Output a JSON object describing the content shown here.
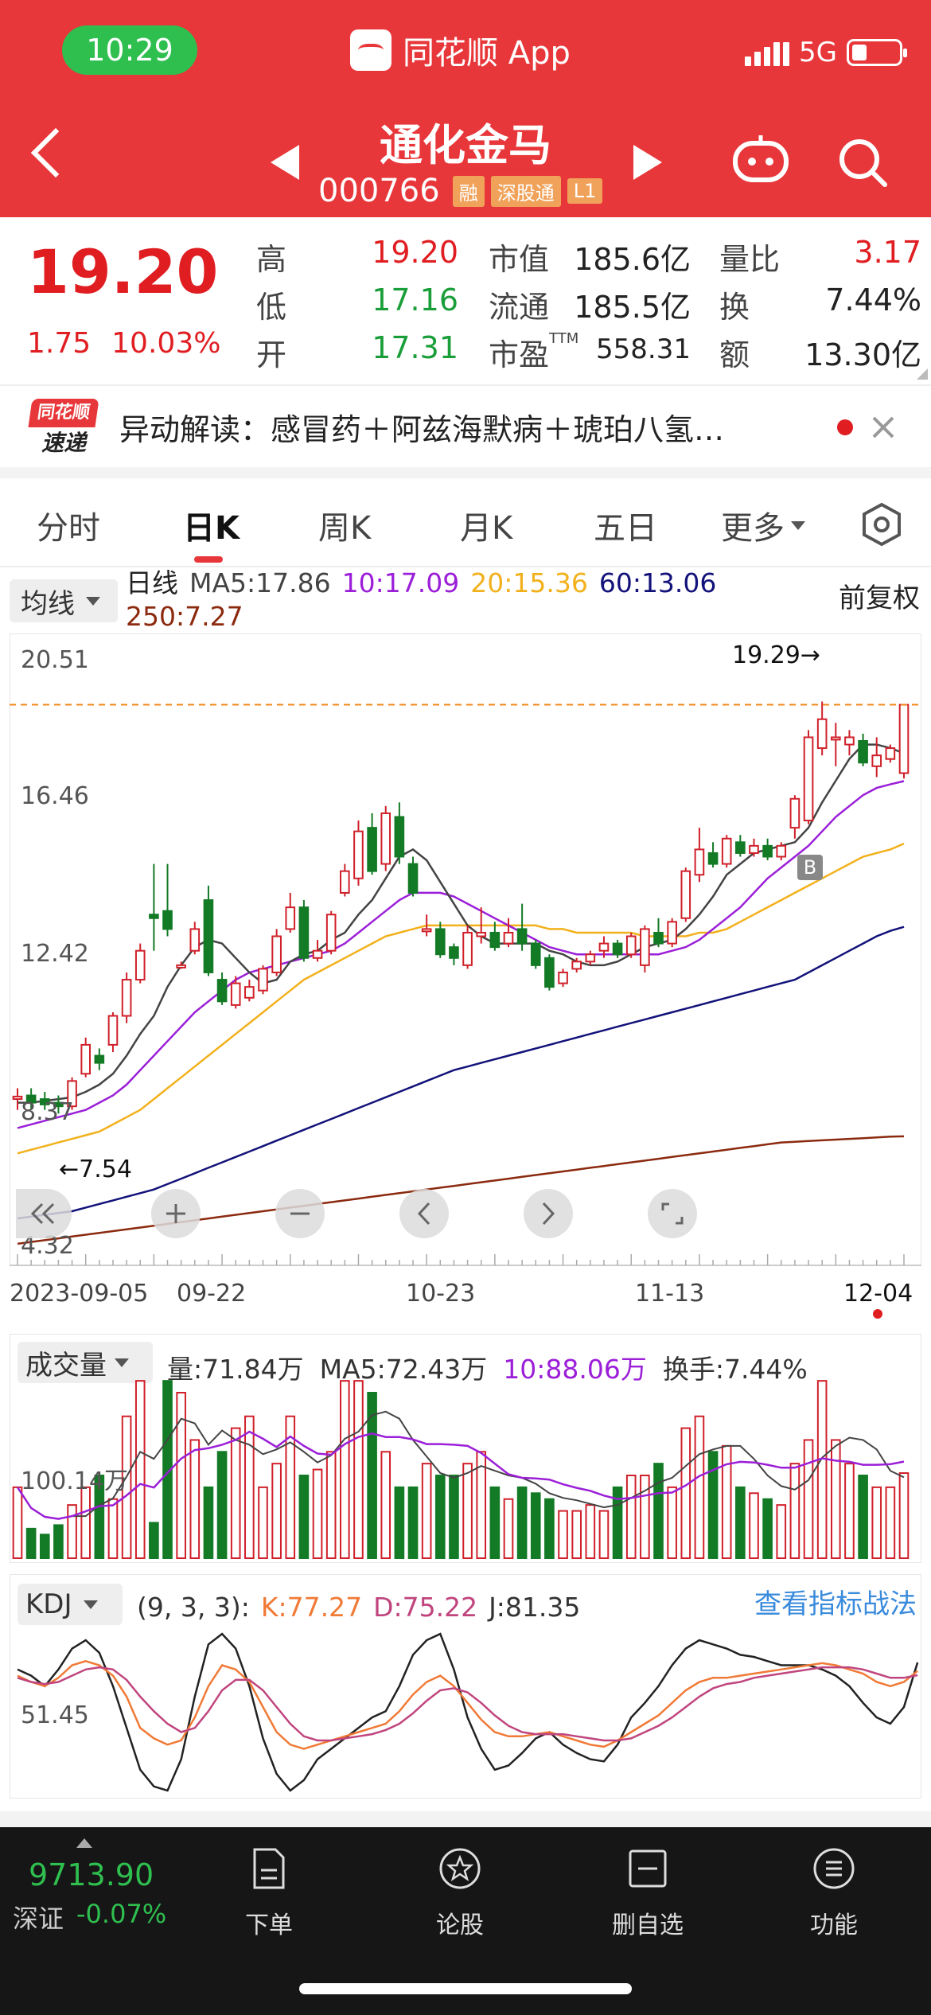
{
  "status_bar": {
    "time": "10:29",
    "app_name": "同花顺 App",
    "network": "5G"
  },
  "header": {
    "stock_name": "通化金马",
    "stock_code": "000766",
    "badges": [
      "融",
      "深股通",
      "L1"
    ]
  },
  "quote": {
    "price": "19.20",
    "change": "1.75",
    "change_pct": "10.03%",
    "high_label": "高",
    "high": "19.20",
    "low_label": "低",
    "low": "17.16",
    "open_label": "开",
    "open": "17.31",
    "mcap_label": "市值",
    "mcap": "185.6亿",
    "float_label": "流通",
    "float": "185.5亿",
    "pe_label": "市盈",
    "pe_sup": "TTM",
    "pe": "558.31",
    "vol_ratio_label": "量比",
    "vol_ratio": "3.17",
    "turnover_label": "换",
    "turnover": "7.44%",
    "amount_label": "额",
    "amount": "13.30亿"
  },
  "news": {
    "logo_top": "同花顺",
    "logo_bottom": "速递",
    "text": "异动解读：感冒药＋阿兹海默病＋琥珀八氢…"
  },
  "tabs": [
    "分时",
    "日K",
    "周K",
    "月K",
    "五日",
    "更多"
  ],
  "active_tab": "日K",
  "ma_legend": {
    "select_label": "均线",
    "type": "日线",
    "ma5": "MA5:17.86",
    "ma10": "10:17.09",
    "ma20": "20:15.36",
    "ma60": "60:13.06",
    "ma250": "250:7.27",
    "adjust": "前复权"
  },
  "colors": {
    "up": "#d0202a",
    "down": "#137a25",
    "ma5": "#444444",
    "ma10": "#9b1fd8",
    "ma20": "#f2b11c",
    "ma60": "#12127a",
    "ma250": "#8b2a0f",
    "k": "#f07a36",
    "d": "#c0457e",
    "j": "#222222"
  },
  "chart_labels": {
    "y_ticks": [
      "20.51",
      "16.46",
      "12.42",
      "8.37",
      "4.32"
    ],
    "x_ticks": [
      "2023-09-05",
      "09-22",
      "10-23",
      "11-13",
      "12-04"
    ],
    "max_marker": "19.29→",
    "min_marker": "←7.54",
    "buy_marker": "B"
  },
  "volume": {
    "select_label": "成交量",
    "vol": "量:71.84万",
    "ma5": "MA5:72.43万",
    "ma10": "10:88.06万",
    "turnover": "换手:7.44%",
    "y_tick": "100.14万"
  },
  "kdj": {
    "select_label": "KDJ",
    "params": "(9, 3, 3):",
    "k": "K:77.27",
    "d": "D:75.22",
    "j": "J:81.35",
    "link": "查看指标战法",
    "y_tick": "51.45"
  },
  "bottom": {
    "index_value": "9713.90",
    "index_name": "深证",
    "index_change": "-0.07%",
    "nav": [
      "下单",
      "论股",
      "删自选",
      "功能"
    ]
  },
  "chart_data": {
    "type": "candlestick",
    "ylim": [
      4.32,
      20.51
    ],
    "y_ticks": [
      20.51,
      16.46,
      12.42,
      8.37,
      4.32
    ],
    "x_ticks": [
      "2023-09-05",
      "09-22",
      "10-23",
      "11-13",
      "12-04"
    ],
    "candles": [
      {
        "o": 8.3,
        "c": 8.37,
        "h": 8.6,
        "l": 8.0
      },
      {
        "o": 8.4,
        "c": 8.2,
        "h": 8.6,
        "l": 8.0
      },
      {
        "o": 8.3,
        "c": 8.15,
        "h": 8.5,
        "l": 8.0
      },
      {
        "o": 8.2,
        "c": 8.1,
        "h": 8.4,
        "l": 7.9
      },
      {
        "o": 8.1,
        "c": 8.8,
        "h": 8.9,
        "l": 8.0
      },
      {
        "o": 9.0,
        "c": 9.8,
        "h": 10.0,
        "l": 8.9
      },
      {
        "o": 9.5,
        "c": 9.3,
        "h": 9.7,
        "l": 9.1
      },
      {
        "o": 9.8,
        "c": 10.6,
        "h": 10.7,
        "l": 9.6
      },
      {
        "o": 10.6,
        "c": 11.6,
        "h": 11.8,
        "l": 10.4
      },
      {
        "o": 11.6,
        "c": 12.4,
        "h": 12.6,
        "l": 11.5
      },
      {
        "o": 13.4,
        "c": 13.3,
        "h": 14.8,
        "l": 12.4
      },
      {
        "o": 13.5,
        "c": 13.0,
        "h": 14.8,
        "l": 12.8
      },
      {
        "o": 12.0,
        "c": 12.0,
        "h": 12.1,
        "l": 11.9
      },
      {
        "o": 12.4,
        "c": 13.0,
        "h": 13.2,
        "l": 12.3
      },
      {
        "o": 13.8,
        "c": 11.8,
        "h": 14.2,
        "l": 11.7
      },
      {
        "o": 11.6,
        "c": 11.0,
        "h": 11.8,
        "l": 10.9
      },
      {
        "o": 10.9,
        "c": 11.5,
        "h": 11.7,
        "l": 10.8
      },
      {
        "o": 11.1,
        "c": 11.4,
        "h": 11.6,
        "l": 11.0
      },
      {
        "o": 11.3,
        "c": 11.9,
        "h": 12.0,
        "l": 11.2
      },
      {
        "o": 11.8,
        "c": 12.8,
        "h": 13.0,
        "l": 11.7
      },
      {
        "o": 13.0,
        "c": 13.6,
        "h": 14.0,
        "l": 12.9
      },
      {
        "o": 13.6,
        "c": 12.2,
        "h": 13.8,
        "l": 12.1
      },
      {
        "o": 12.2,
        "c": 12.4,
        "h": 12.7,
        "l": 12.1
      },
      {
        "o": 12.4,
        "c": 13.4,
        "h": 13.5,
        "l": 12.3
      },
      {
        "o": 14.0,
        "c": 14.6,
        "h": 14.8,
        "l": 13.9
      },
      {
        "o": 14.4,
        "c": 15.7,
        "h": 16.0,
        "l": 14.2
      },
      {
        "o": 15.8,
        "c": 14.6,
        "h": 16.2,
        "l": 14.5
      },
      {
        "o": 14.8,
        "c": 16.2,
        "h": 16.4,
        "l": 14.6
      },
      {
        "o": 16.1,
        "c": 15.0,
        "h": 16.5,
        "l": 14.8
      },
      {
        "o": 14.8,
        "c": 14.0,
        "h": 15.0,
        "l": 13.9
      },
      {
        "o": 13.0,
        "c": 13.0,
        "h": 13.4,
        "l": 12.8
      },
      {
        "o": 13.0,
        "c": 12.3,
        "h": 13.2,
        "l": 12.2
      },
      {
        "o": 12.5,
        "c": 12.2,
        "h": 12.6,
        "l": 12.0
      },
      {
        "o": 12.0,
        "c": 12.9,
        "h": 13.1,
        "l": 11.9
      },
      {
        "o": 12.8,
        "c": 12.9,
        "h": 13.6,
        "l": 12.6
      },
      {
        "o": 12.9,
        "c": 12.5,
        "h": 13.2,
        "l": 12.4
      },
      {
        "o": 12.6,
        "c": 12.9,
        "h": 13.3,
        "l": 12.5
      },
      {
        "o": 13.0,
        "c": 12.6,
        "h": 13.7,
        "l": 12.4
      },
      {
        "o": 12.6,
        "c": 12.0,
        "h": 12.7,
        "l": 11.9
      },
      {
        "o": 12.2,
        "c": 11.4,
        "h": 12.3,
        "l": 11.3
      },
      {
        "o": 11.5,
        "c": 11.8,
        "h": 11.9,
        "l": 11.4
      },
      {
        "o": 11.9,
        "c": 12.1,
        "h": 12.2,
        "l": 11.8
      },
      {
        "o": 12.1,
        "c": 12.3,
        "h": 12.4,
        "l": 12.0
      },
      {
        "o": 12.4,
        "c": 12.6,
        "h": 12.8,
        "l": 12.2
      },
      {
        "o": 12.6,
        "c": 12.3,
        "h": 12.7,
        "l": 12.2
      },
      {
        "o": 12.3,
        "c": 12.8,
        "h": 12.9,
        "l": 12.2
      },
      {
        "o": 12.0,
        "c": 13.0,
        "h": 13.1,
        "l": 11.8
      },
      {
        "o": 12.9,
        "c": 12.6,
        "h": 13.3,
        "l": 12.5
      },
      {
        "o": 12.6,
        "c": 13.2,
        "h": 13.3,
        "l": 12.5
      },
      {
        "o": 13.3,
        "c": 14.6,
        "h": 14.7,
        "l": 13.2
      },
      {
        "o": 14.5,
        "c": 15.2,
        "h": 15.8,
        "l": 14.3
      },
      {
        "o": 15.1,
        "c": 14.8,
        "h": 15.4,
        "l": 14.7
      },
      {
        "o": 14.8,
        "c": 15.5,
        "h": 15.6,
        "l": 14.7
      },
      {
        "o": 15.4,
        "c": 15.1,
        "h": 15.6,
        "l": 15.0
      },
      {
        "o": 15.1,
        "c": 15.3,
        "h": 15.5,
        "l": 15.0
      },
      {
        "o": 15.3,
        "c": 15.0,
        "h": 15.5,
        "l": 14.9
      },
      {
        "o": 15.0,
        "c": 15.3,
        "h": 15.4,
        "l": 14.9
      },
      {
        "o": 15.8,
        "c": 16.6,
        "h": 16.7,
        "l": 15.5
      },
      {
        "o": 16.0,
        "c": 18.3,
        "h": 18.5,
        "l": 15.9
      },
      {
        "o": 18.0,
        "c": 18.8,
        "h": 19.29,
        "l": 17.8
      },
      {
        "o": 18.3,
        "c": 18.3,
        "h": 18.7,
        "l": 17.5
      },
      {
        "o": 18.1,
        "c": 18.3,
        "h": 18.5,
        "l": 17.8
      },
      {
        "o": 18.2,
        "c": 17.6,
        "h": 18.4,
        "l": 17.5
      },
      {
        "o": 17.5,
        "c": 17.8,
        "h": 18.3,
        "l": 17.2
      },
      {
        "o": 17.7,
        "c": 18.0,
        "h": 18.1,
        "l": 17.6
      },
      {
        "o": 17.31,
        "c": 19.2,
        "h": 19.2,
        "l": 17.16
      }
    ],
    "ma5": [
      8.2,
      8.2,
      8.25,
      8.3,
      8.35,
      8.5,
      8.7,
      9.0,
      9.5,
      10.1,
      10.6,
      11.4,
      12.0,
      12.5,
      12.7,
      12.6,
      12.2,
      11.8,
      11.5,
      11.6,
      12.1,
      12.3,
      12.4,
      12.7,
      12.9,
      13.4,
      13.8,
      14.4,
      15.0,
      15.2,
      14.9,
      14.3,
      13.7,
      13.1,
      12.8,
      12.6,
      12.6,
      12.6,
      12.6,
      12.4,
      12.3,
      12.1,
      12.0,
      12.0,
      12.1,
      12.3,
      12.5,
      12.6,
      12.7,
      13.0,
      13.4,
      13.9,
      14.5,
      14.8,
      15.1,
      15.2,
      15.3,
      15.4,
      15.8,
      16.5,
      17.1,
      17.7,
      18.1,
      18.1,
      18.0,
      17.86
    ],
    "ma10": [
      7.5,
      7.6,
      7.7,
      7.8,
      7.9,
      8.0,
      8.2,
      8.4,
      8.7,
      9.1,
      9.5,
      9.9,
      10.3,
      10.7,
      11.0,
      11.3,
      11.6,
      11.8,
      11.9,
      12.0,
      12.1,
      12.2,
      12.3,
      12.4,
      12.6,
      12.9,
      13.2,
      13.5,
      13.8,
      14.0,
      14.0,
      14.0,
      13.9,
      13.7,
      13.5,
      13.3,
      13.1,
      12.9,
      12.7,
      12.5,
      12.4,
      12.3,
      12.3,
      12.3,
      12.3,
      12.3,
      12.3,
      12.3,
      12.4,
      12.5,
      12.7,
      13.0,
      13.3,
      13.6,
      14.0,
      14.4,
      14.7,
      15.0,
      15.3,
      15.7,
      16.1,
      16.4,
      16.7,
      16.9,
      17.0,
      17.09
    ],
    "ma20": [
      6.8,
      6.9,
      7.0,
      7.1,
      7.2,
      7.3,
      7.4,
      7.6,
      7.8,
      8.0,
      8.3,
      8.6,
      8.9,
      9.2,
      9.5,
      9.8,
      10.1,
      10.4,
      10.7,
      11.0,
      11.3,
      11.6,
      11.8,
      12.0,
      12.2,
      12.4,
      12.6,
      12.8,
      12.9,
      13.0,
      13.1,
      13.1,
      13.1,
      13.1,
      13.1,
      13.1,
      13.1,
      13.1,
      13.1,
      13.0,
      13.0,
      12.9,
      12.9,
      12.9,
      12.9,
      12.9,
      12.8,
      12.8,
      12.8,
      12.8,
      12.9,
      12.9,
      13.0,
      13.2,
      13.4,
      13.6,
      13.8,
      14.0,
      14.2,
      14.4,
      14.6,
      14.8,
      15.0,
      15.1,
      15.2,
      15.36
    ],
    "ma60": [
      5.0,
      5.05,
      5.1,
      5.15,
      5.2,
      5.3,
      5.4,
      5.5,
      5.6,
      5.7,
      5.8,
      5.95,
      6.1,
      6.25,
      6.4,
      6.55,
      6.7,
      6.85,
      7.0,
      7.15,
      7.3,
      7.45,
      7.6,
      7.75,
      7.9,
      8.05,
      8.2,
      8.35,
      8.5,
      8.65,
      8.8,
      8.95,
      9.1,
      9.2,
      9.3,
      9.4,
      9.5,
      9.6,
      9.7,
      9.8,
      9.9,
      10.0,
      10.1,
      10.2,
      10.3,
      10.4,
      10.5,
      10.6,
      10.7,
      10.8,
      10.9,
      11.0,
      11.1,
      11.2,
      11.3,
      11.4,
      11.5,
      11.6,
      11.8,
      12.0,
      12.2,
      12.4,
      12.6,
      12.8,
      12.95,
      13.06
    ],
    "ma250": [
      4.3,
      4.35,
      4.4,
      4.45,
      4.5,
      4.55,
      4.6,
      4.65,
      4.7,
      4.75,
      4.8,
      4.85,
      4.9,
      4.95,
      5.0,
      5.05,
      5.1,
      5.15,
      5.2,
      5.25,
      5.3,
      5.35,
      5.4,
      5.45,
      5.5,
      5.55,
      5.6,
      5.65,
      5.7,
      5.75,
      5.8,
      5.85,
      5.9,
      5.95,
      6.0,
      6.05,
      6.1,
      6.15,
      6.2,
      6.25,
      6.3,
      6.35,
      6.4,
      6.45,
      6.5,
      6.55,
      6.6,
      6.65,
      6.7,
      6.75,
      6.8,
      6.85,
      6.9,
      6.95,
      7.0,
      7.05,
      7.1,
      7.12,
      7.14,
      7.16,
      7.18,
      7.2,
      7.22,
      7.24,
      7.26,
      7.27
    ],
    "volume": {
      "ylim": [
        0,
        140
      ],
      "bars": [
        60,
        25,
        20,
        28,
        45,
        60,
        70,
        50,
        120,
        150,
        30,
        150,
        140,
        100,
        60,
        90,
        110,
        120,
        60,
        80,
        120,
        70,
        75,
        90,
        150,
        150,
        140,
        90,
        60,
        60,
        80,
        70,
        70,
        80,
        90,
        60,
        50,
        60,
        55,
        50,
        40,
        40,
        45,
        40,
        60,
        70,
        70,
        80,
        60,
        110,
        120,
        90,
        95,
        60,
        55,
        50,
        45,
        80,
        100,
        150,
        100,
        80,
        70,
        60,
        60,
        72
      ]
    },
    "kdj": {
      "ylim": [
        20,
        100
      ],
      "k": [
        75,
        72,
        70,
        74,
        80,
        82,
        80,
        75,
        65,
        50,
        45,
        42,
        44,
        55,
        70,
        80,
        78,
        72,
        60,
        48,
        42,
        40,
        42,
        44,
        46,
        48,
        50,
        52,
        58,
        66,
        72,
        75,
        70,
        62,
        54,
        48,
        46,
        46,
        47,
        48,
        46,
        44,
        42,
        41,
        44,
        48,
        52,
        56,
        62,
        68,
        72,
        74,
        74,
        75,
        76,
        77,
        78,
        79,
        80,
        81,
        80,
        78,
        76,
        72,
        70,
        72,
        77.27
      ],
      "d": [
        74,
        72,
        71,
        72,
        75,
        78,
        79,
        78,
        73,
        65,
        58,
        52,
        48,
        50,
        58,
        68,
        73,
        73,
        68,
        60,
        52,
        46,
        44,
        44,
        45,
        46,
        47,
        49,
        52,
        57,
        63,
        68,
        69,
        67,
        62,
        56,
        51,
        48,
        47,
        47,
        47,
        46,
        45,
        44,
        44,
        45,
        48,
        51,
        55,
        60,
        65,
        69,
        71,
        72,
        74,
        75,
        76,
        77,
        78,
        79,
        79,
        79,
        78,
        76,
        74,
        74,
        75.22
      ],
      "j": [
        78,
        75,
        70,
        78,
        88,
        92,
        86,
        70,
        50,
        30,
        22,
        20,
        35,
        65,
        90,
        95,
        88,
        70,
        45,
        28,
        20,
        25,
        35,
        40,
        45,
        50,
        55,
        58,
        70,
        85,
        92,
        95,
        78,
        55,
        40,
        30,
        32,
        38,
        45,
        48,
        42,
        38,
        35,
        34,
        42,
        55,
        62,
        70,
        80,
        88,
        92,
        90,
        88,
        85,
        84,
        82,
        80,
        80,
        80,
        78,
        75,
        70,
        62,
        55,
        52,
        60,
        81.35
      ]
    }
  }
}
